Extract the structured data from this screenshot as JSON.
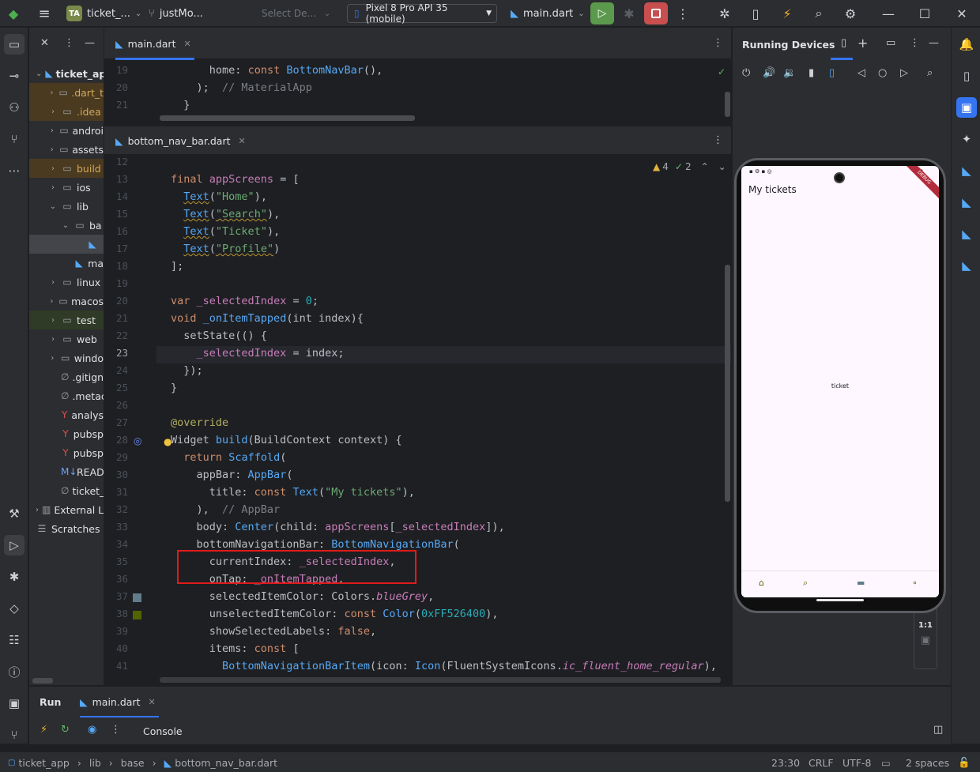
{
  "titlebar": {
    "project_badge": "TA",
    "project_name": "ticket_...",
    "branch": "justMo...",
    "select_device": "Select De...",
    "device": "Pixel 8 Pro API 35 (mobile)",
    "run_config": "main.dart"
  },
  "project_tree": [
    {
      "label": "ticket_ap",
      "kind": "root"
    },
    {
      "label": ".dart_t",
      "kind": "excluded"
    },
    {
      "label": ".idea",
      "kind": "excluded"
    },
    {
      "label": "androi",
      "kind": "folder"
    },
    {
      "label": "assets",
      "kind": "folder"
    },
    {
      "label": "build",
      "kind": "excluded"
    },
    {
      "label": "ios",
      "kind": "folder"
    },
    {
      "label": "lib",
      "kind": "open"
    },
    {
      "label": "ba",
      "kind": "open"
    },
    {
      "label": "",
      "kind": "selected"
    },
    {
      "label": "ma",
      "kind": "dart"
    },
    {
      "label": "linux",
      "kind": "folder"
    },
    {
      "label": "macos",
      "kind": "folder"
    },
    {
      "label": "test",
      "kind": "test"
    },
    {
      "label": "web",
      "kind": "folder"
    },
    {
      "label": "windo",
      "kind": "folder"
    },
    {
      "label": ".gitign",
      "kind": "file"
    },
    {
      "label": ".metac",
      "kind": "file"
    },
    {
      "label": "analys",
      "kind": "yaml"
    },
    {
      "label": "pubsp",
      "kind": "yaml"
    },
    {
      "label": "pubsp",
      "kind": "yaml"
    },
    {
      "label": "READI",
      "kind": "md"
    },
    {
      "label": "ticket_",
      "kind": "file"
    },
    {
      "label": "External L",
      "kind": "lib"
    },
    {
      "label": "Scratches",
      "kind": "scratch"
    }
  ],
  "editor_top": {
    "tab": "main.dart",
    "lines": [
      {
        "n": "19",
        "html": "      <span>home</span>: <span class='kw'>const</span> <span class='cls'>BottomNavBar</span>(),"
      },
      {
        "n": "20",
        "html": "    );  <span class='cmt'>// MaterialApp</span>"
      },
      {
        "n": "21",
        "html": "  }"
      }
    ]
  },
  "editor_bottom": {
    "tab": "bottom_nav_bar.dart",
    "warnings": "4",
    "checks": "2",
    "lines": [
      {
        "n": "12",
        "html": ""
      },
      {
        "n": "13",
        "html": "<span class='kw'>final</span> <span class='fld'>appScreens</span> = ["
      },
      {
        "n": "14",
        "html": "  <span class='cls squig'>Text</span>(<span class='str'>\"Home\"</span>),"
      },
      {
        "n": "15",
        "html": "  <span class='cls squig'>Text</span>(<span class='str squig'>\"Search\"</span>),"
      },
      {
        "n": "16",
        "html": "  <span class='cls squig'>Text</span>(<span class='str'>\"Ticket\"</span>),"
      },
      {
        "n": "17",
        "html": "  <span class='cls squig'>Text</span>(<span class='str squig'>\"Profile\"</span>)"
      },
      {
        "n": "18",
        "html": "];"
      },
      {
        "n": "19",
        "html": ""
      },
      {
        "n": "20",
        "html": "<span class='kw'>var</span> <span class='fld'>_selectedIndex</span> = <span class='num'>0</span>;"
      },
      {
        "n": "21",
        "html": "<span class='kw'>void</span> <span class='fn'>_onItemTapped</span>(int index){"
      },
      {
        "n": "22",
        "html": "  setState(() {"
      },
      {
        "n": "23",
        "html": "    <span class='fld'>_selectedIndex</span> = index;"
      },
      {
        "n": "24",
        "html": "  });"
      },
      {
        "n": "25",
        "html": "}"
      },
      {
        "n": "26",
        "html": ""
      },
      {
        "n": "27",
        "html": "<span class='ann'>@override</span>"
      },
      {
        "n": "28",
        "html": "Widget <span class='fn'>build</span>(BuildContext context) {"
      },
      {
        "n": "29",
        "html": "  <span class='kw'>return</span> <span class='cls'>Scaffold</span>("
      },
      {
        "n": "30",
        "html": "    appBar: <span class='cls'>AppBar</span>("
      },
      {
        "n": "31",
        "html": "      title: <span class='kw'>const</span> <span class='cls'>Text</span>(<span class='str'>\"My tickets\"</span>),"
      },
      {
        "n": "32",
        "html": "    ),  <span class='cmt'>// AppBar</span>"
      },
      {
        "n": "33",
        "html": "    body: <span class='cls'>Center</span>(child: <span class='fld'>appScreens</span>[<span class='fld'>_selectedIndex</span>]),"
      },
      {
        "n": "34",
        "html": "    bottomNavigationBar: <span class='cls'>BottomNavigationBar</span>("
      },
      {
        "n": "35",
        "html": "      currentIndex: <span class='fld'>_selectedIndex</span>,"
      },
      {
        "n": "36",
        "html": "      onTap: <span class='fld'>_onItemTapped</span>,"
      },
      {
        "n": "37",
        "html": "      selectedItemColor: Colors.<span class='fld ital'>blueGrey</span>,"
      },
      {
        "n": "38",
        "html": "      unselectedItemColor: <span class='kw'>const</span> <span class='cls'>Color</span>(<span class='num'>0xFF526400</span>),"
      },
      {
        "n": "39",
        "html": "      showSelectedLabels: <span class='kw'>false</span>,"
      },
      {
        "n": "40",
        "html": "      items: <span class='kw'>const</span> ["
      },
      {
        "n": "41",
        "html": "        <span class='cls'>BottomNavigationBarItem</span>(icon: <span class='cls'>Icon</span>(FluentSystemIcons.<span class='fld ital'>ic_fluent_home_regular</span>),"
      }
    ]
  },
  "running_devices": {
    "title": "Running Devices",
    "app_title": "My tickets",
    "body_text": "ticket",
    "zoom_label": "1:1"
  },
  "run_panel": {
    "run_tab": "Run",
    "config_tab": "main.dart",
    "console_tab": "Console"
  },
  "statusbar": {
    "crumb1": "ticket_app",
    "crumb2": "lib",
    "crumb3": "base",
    "crumb4": "bottom_nav_bar.dart",
    "position": "23:30",
    "line_sep": "CRLF",
    "encoding": "UTF-8",
    "indent": "2 spaces"
  },
  "colors": {
    "accent": "#3574f0",
    "highlight_box": "#e01b1b",
    "swatch_bluegrey": "#607d8b",
    "swatch_olive": "#526400"
  }
}
